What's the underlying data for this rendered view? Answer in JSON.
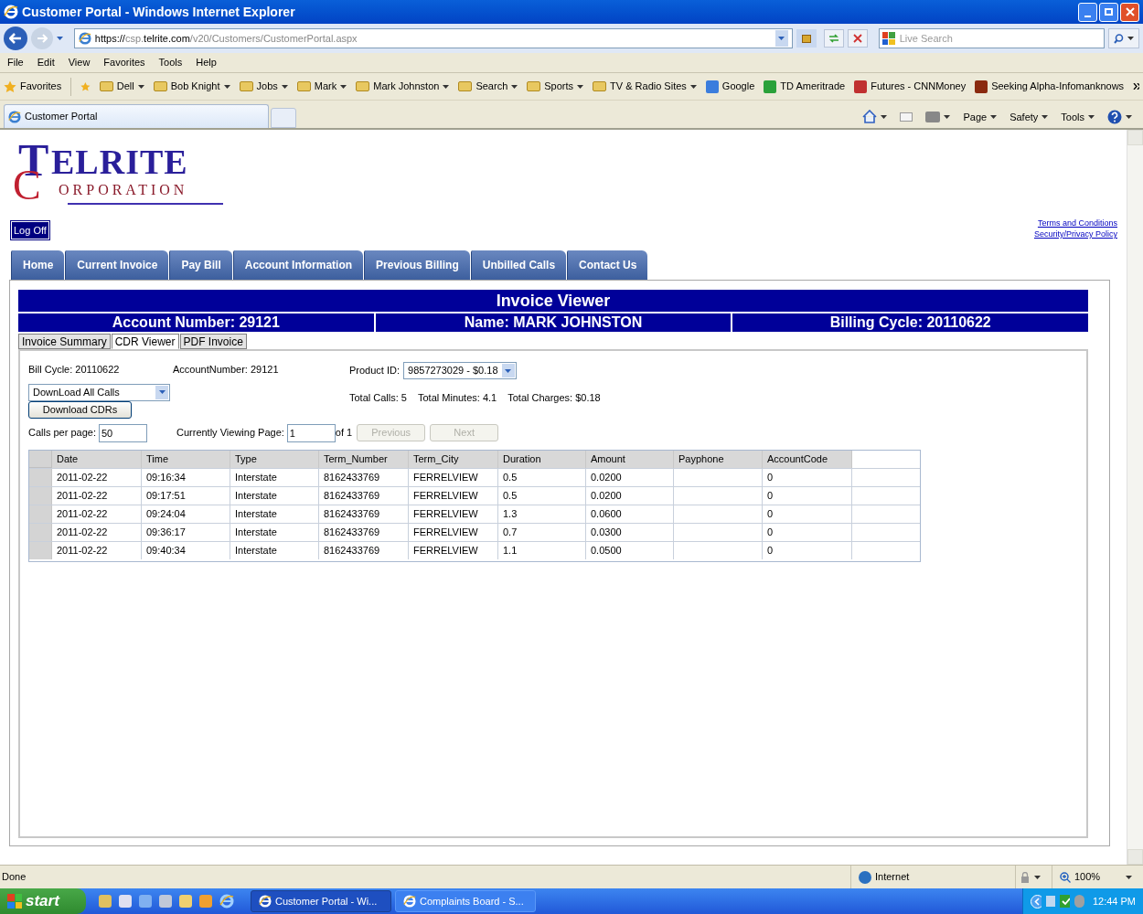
{
  "window": {
    "title": "Customer Portal - Windows Internet Explorer"
  },
  "address_bar": {
    "url_scheme": "https://",
    "url_host_start": "csp.",
    "url_domain": "telrite.com",
    "url_path": "/v20/Customers/CustomerPortal.aspx"
  },
  "search": {
    "placeholder": "Live Search"
  },
  "menu": [
    "File",
    "Edit",
    "View",
    "Favorites",
    "Tools",
    "Help"
  ],
  "favorites_bar": {
    "label": "Favorites",
    "items": [
      {
        "label": "Dell",
        "kind": "folder"
      },
      {
        "label": "Bob Knight",
        "kind": "folder"
      },
      {
        "label": "Jobs",
        "kind": "folder"
      },
      {
        "label": "Mark",
        "kind": "folder"
      },
      {
        "label": "Mark Johnston",
        "kind": "folder"
      },
      {
        "label": "Search",
        "kind": "folder"
      },
      {
        "label": "Sports",
        "kind": "folder"
      },
      {
        "label": "TV & Radio Sites",
        "kind": "folder"
      },
      {
        "label": "Google",
        "kind": "link",
        "color": "#3b7ddd"
      },
      {
        "label": "TD Ameritrade",
        "kind": "link",
        "color": "#2aa13a"
      },
      {
        "label": "Futures - CNNMoney",
        "kind": "link",
        "color": "#c03030"
      },
      {
        "label": "Seeking Alpha-Infomanknows",
        "kind": "link",
        "color": "#8a2a10"
      }
    ]
  },
  "browser_tabs": [
    {
      "label": "Customer Portal",
      "selected": true
    }
  ],
  "command_bar": [
    "Page",
    "Safety",
    "Tools"
  ],
  "page": {
    "logo": {
      "initials": [
        "T",
        "C"
      ],
      "words": [
        "ELRITE",
        "ORPORATION"
      ]
    },
    "log_off": "Log Off",
    "links": [
      "Terms and Conditions",
      "Security/Privacy Policy"
    ],
    "nav_tabs": [
      "Home",
      "Current Invoice",
      "Pay Bill",
      "Account Information",
      "Previous Billing",
      "Unbilled Calls",
      "Contact Us"
    ],
    "banner": "Invoice Viewer",
    "info": [
      "Account Number: 29121",
      "Name: MARK JOHNSTON",
      "Billing Cycle: 20110622"
    ],
    "sub_tabs": [
      {
        "label": "Invoice Summary",
        "selected": false
      },
      {
        "label": "CDR Viewer",
        "selected": true
      },
      {
        "label": "PDF Invoice",
        "selected": false
      }
    ],
    "cdr": {
      "bill_cycle": "Bill Cycle: 20110622",
      "account_number": "AccountNumber: 29121",
      "product_label": "Product ID:",
      "product_value": "9857273029 - $0.18",
      "download_select": "DownLoad All Calls",
      "download_button": "Download CDRs",
      "totals": [
        "Total Calls: 5",
        "Total Minutes: 4.1",
        "Total Charges: $0.18"
      ],
      "calls_per_page_label": "Calls per page:",
      "calls_per_page": "50",
      "viewing_label": "Currently Viewing Page:",
      "viewing_page": "1",
      "of_pages": "of 1",
      "previous": {
        "label": "Previous",
        "disabled": true
      },
      "next": {
        "label": "Next",
        "disabled": true
      }
    },
    "table": {
      "columns": [
        "Date",
        "Time",
        "Type",
        "Term_Number",
        "Term_City",
        "Duration",
        "Amount",
        "Payphone",
        "AccountCode"
      ],
      "rows": [
        [
          "2011-02-22",
          "09:16:34",
          "Interstate",
          "8162433769",
          "FERRELVIEW",
          "0.5",
          "0.0200",
          "",
          "0"
        ],
        [
          "2011-02-22",
          "09:17:51",
          "Interstate",
          "8162433769",
          "FERRELVIEW",
          "0.5",
          "0.0200",
          "",
          "0"
        ],
        [
          "2011-02-22",
          "09:24:04",
          "Interstate",
          "8162433769",
          "FERRELVIEW",
          "1.3",
          "0.0600",
          "",
          "0"
        ],
        [
          "2011-02-22",
          "09:36:17",
          "Interstate",
          "8162433769",
          "FERRELVIEW",
          "0.7",
          "0.0300",
          "",
          "0"
        ],
        [
          "2011-02-22",
          "09:40:34",
          "Interstate",
          "8162433769",
          "FERRELVIEW",
          "1.1",
          "0.0500",
          "",
          "0"
        ]
      ]
    }
  },
  "status_bar": {
    "text": "Done",
    "zone": "Internet",
    "zoom": "100%"
  },
  "taskbar": {
    "start": "start",
    "tasks": [
      {
        "label": "Customer Portal - Wi...",
        "selected": true
      },
      {
        "label": "Complaints Board - S...",
        "selected": false
      }
    ],
    "clock": "12:44 PM"
  }
}
